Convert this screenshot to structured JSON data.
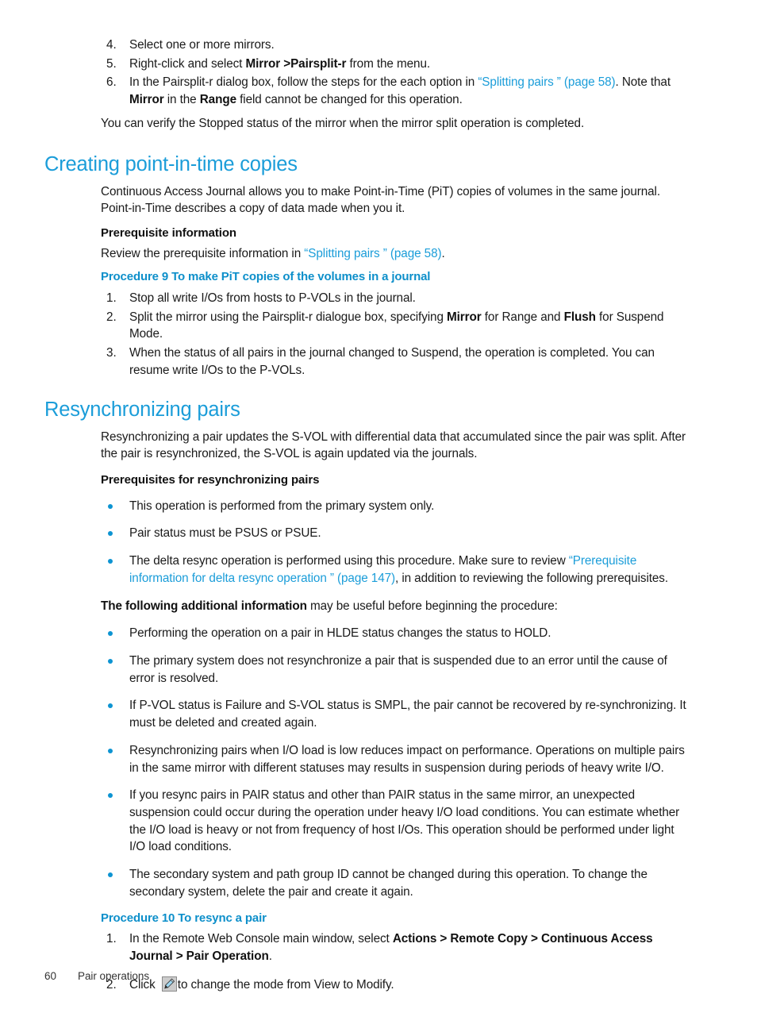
{
  "colors": {
    "heading_blue": "#1b9dd9",
    "procedure_blue": "#0d8fca",
    "link_blue": "#1b9dd9",
    "bullet_blue": "#0d94d2",
    "body_text": "#1a1a1a"
  },
  "top_list": {
    "items": [
      {
        "num": "4.",
        "parts": [
          {
            "t": "Select one or more mirrors.",
            "s": "n"
          }
        ]
      },
      {
        "num": "5.",
        "parts": [
          {
            "t": "Right-click and select ",
            "s": "n"
          },
          {
            "t": "Mirror >Pairsplit-r",
            "s": "b"
          },
          {
            "t": " from the menu.",
            "s": "n"
          }
        ]
      },
      {
        "num": "6.",
        "parts": [
          {
            "t": "In the Pairsplit-r dialog box, follow the steps for the each option in ",
            "s": "n"
          },
          {
            "t": "“Splitting pairs ” (page 58)",
            "s": "l"
          },
          {
            "t": ". Note that ",
            "s": "n"
          },
          {
            "t": "Mirror",
            "s": "b"
          },
          {
            "t": " in the ",
            "s": "n"
          },
          {
            "t": "Range",
            "s": "b"
          },
          {
            "t": " field cannot be changed for this operation.",
            "s": "n"
          }
        ]
      }
    ]
  },
  "verify_paragraph": {
    "parts": [
      {
        "t": "You can verify the Stopped status of the mirror when the mirror split operation is completed.",
        "s": "n"
      }
    ]
  },
  "section_pit": {
    "heading": "Creating point-in-time copies",
    "intro": {
      "parts": [
        {
          "t": "Continuous Access Journal allows you to make Point-in-Time (PiT) copies of volumes in the same journal. Point-in-Time describes a copy of data made when you it.",
          "s": "n"
        }
      ]
    },
    "prereq_heading": "Prerequisite information",
    "prereq_paragraph": {
      "parts": [
        {
          "t": "Review the prerequisite information in ",
          "s": "n"
        },
        {
          "t": "“Splitting pairs ” (page 58)",
          "s": "l"
        },
        {
          "t": ".",
          "s": "n"
        }
      ]
    },
    "procedure_heading": "Procedure 9 To make PiT copies of the volumes in a journal",
    "steps": [
      {
        "num": "1.",
        "parts": [
          {
            "t": "Stop all write I/Os from hosts to P-VOLs in the journal.",
            "s": "n"
          }
        ]
      },
      {
        "num": "2.",
        "parts": [
          {
            "t": "Split the mirror using the Pairsplit-r dialogue box, specifying ",
            "s": "n"
          },
          {
            "t": "Mirror",
            "s": "b"
          },
          {
            "t": " for Range and ",
            "s": "n"
          },
          {
            "t": "Flush",
            "s": "b"
          },
          {
            "t": " for Suspend Mode.",
            "s": "n"
          }
        ]
      },
      {
        "num": "3.",
        "parts": [
          {
            "t": "When the status of all pairs in the journal changed to Suspend, the operation is completed. You can resume write I/Os to the P-VOLs.",
            "s": "n"
          }
        ]
      }
    ]
  },
  "section_resync": {
    "heading": "Resynchronizing pairs",
    "intro": {
      "parts": [
        {
          "t": "Resynchronizing a pair updates the S-VOL with differential data that accumulated since the pair was split. After the pair is resynchronized, the S-VOL is again updated via the journals.",
          "s": "n"
        }
      ]
    },
    "prereq_heading": "Prerequisites for resynchronizing pairs",
    "prereq_bullets": [
      {
        "parts": [
          {
            "t": "This operation is performed from the primary system only.",
            "s": "n"
          }
        ]
      },
      {
        "parts": [
          {
            "t": "Pair status must be PSUS or PSUE.",
            "s": "n"
          }
        ]
      },
      {
        "parts": [
          {
            "t": "The delta resync operation is performed using this procedure. Make sure to review ",
            "s": "n"
          },
          {
            "t": "“Prerequisite information for delta resync operation ” (page 147)",
            "s": "l"
          },
          {
            "t": ", in addition to reviewing the following prerequisites.",
            "s": "n"
          }
        ]
      }
    ],
    "additional_info_lead": {
      "parts": [
        {
          "t": "The following additional information",
          "s": "b"
        },
        {
          "t": " may be useful before beginning the procedure:",
          "s": "n"
        }
      ]
    },
    "additional_bullets": [
      {
        "parts": [
          {
            "t": "Performing the operation on a pair in HLDE status changes the status to HOLD.",
            "s": "n"
          }
        ]
      },
      {
        "parts": [
          {
            "t": "The primary system does not resynchronize a pair that is suspended due to an error until the cause of error is resolved.",
            "s": "n"
          }
        ]
      },
      {
        "parts": [
          {
            "t": "If P-VOL status is Failure and S-VOL status is SMPL, the pair cannot be recovered by re-synchronizing. It must be deleted and created again.",
            "s": "n"
          }
        ]
      },
      {
        "parts": [
          {
            "t": "Resynchronizing pairs when I/O load is low reduces impact on performance. Operations on multiple pairs in the same mirror with different statuses may results in suspension during periods of heavy write I/O.",
            "s": "n"
          }
        ]
      },
      {
        "parts": [
          {
            "t": "If you resync pairs in PAIR status and other than PAIR status in the same mirror, an unexpected suspension could occur during the operation under heavy I/O load conditions. You can estimate whether the I/O load is heavy or not from frequency of host I/Os. This operation should be performed under light I/O load conditions.",
            "s": "n"
          }
        ]
      },
      {
        "parts": [
          {
            "t": "The secondary system and path group ID cannot be changed during this operation. To change the secondary system, delete the pair and create it again.",
            "s": "n"
          }
        ]
      }
    ],
    "procedure_heading": "Procedure 10 To resync a pair",
    "steps": [
      {
        "num": "1.",
        "parts": [
          {
            "t": "In the Remote Web Console main window, select ",
            "s": "n"
          },
          {
            "t": "Actions > Remote Copy > Continuous Access Journal > Pair Operation",
            "s": "b"
          },
          {
            "t": ".",
            "s": "n"
          }
        ]
      },
      {
        "num": "2.",
        "parts": [
          {
            "t": "Click ",
            "s": "n"
          },
          {
            "t": "",
            "s": "icon",
            "icon": "pencil-icon"
          },
          {
            "t": "to change the mode from View to Modify.",
            "s": "n"
          }
        ]
      }
    ]
  },
  "footer": {
    "page_number": "60",
    "title": "Pair operations"
  }
}
